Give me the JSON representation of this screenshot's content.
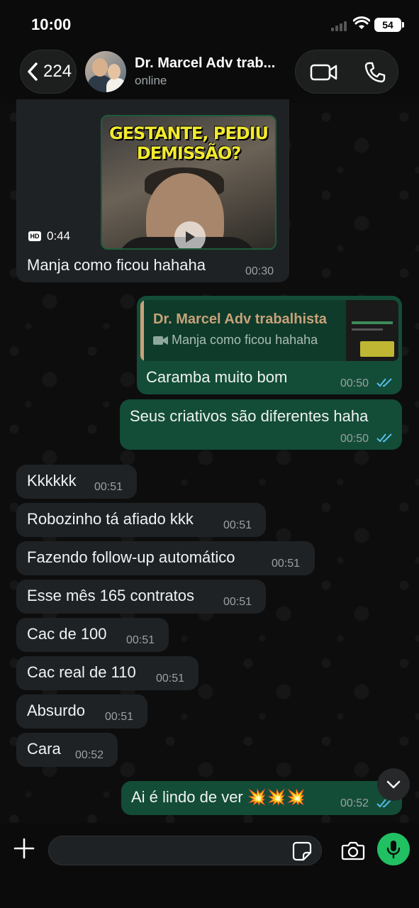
{
  "status_bar": {
    "time": "10:00",
    "battery": "54"
  },
  "header": {
    "back_count": "224",
    "contact_name": "Dr. Marcel Adv trab...",
    "contact_status": "online"
  },
  "messages": [
    {
      "id": "m1",
      "direction": "in",
      "type": "video",
      "video_title": "GESTANTE, PEDIU DEMISSÃO?",
      "duration": "0:44",
      "text": "Manja como ficou hahaha",
      "time": "00:30"
    },
    {
      "id": "m2",
      "direction": "out",
      "type": "reply",
      "quote_name": "Dr. Marcel Adv trabalhista",
      "quote_text": "Manja como ficou hahaha",
      "text": "Caramba muito bom",
      "time": "00:50"
    },
    {
      "id": "m3",
      "direction": "out",
      "text": "Seus criativos são diferentes haha",
      "time": "00:50"
    },
    {
      "id": "m4",
      "direction": "in",
      "text": "Kkkkkk",
      "time": "00:51"
    },
    {
      "id": "m5",
      "direction": "in",
      "text": "Robozinho tá afiado kkk",
      "time": "00:51"
    },
    {
      "id": "m6",
      "direction": "in",
      "text": "Fazendo follow-up automático",
      "time": "00:51"
    },
    {
      "id": "m7",
      "direction": "in",
      "text": "Esse mês 165 contratos",
      "time": "00:51"
    },
    {
      "id": "m8",
      "direction": "in",
      "text": "Cac de 100",
      "time": "00:51"
    },
    {
      "id": "m9",
      "direction": "in",
      "text": "Cac real de 110",
      "time": "00:51"
    },
    {
      "id": "m10",
      "direction": "in",
      "text": "Absurdo",
      "time": "00:51"
    },
    {
      "id": "m11",
      "direction": "in",
      "text": "Cara",
      "time": "00:52"
    },
    {
      "id": "m12",
      "direction": "out",
      "text": "Ai é lindo de ver 💥💥💥",
      "time": "00:52"
    }
  ],
  "composer": {
    "input_value": "",
    "placeholder": ""
  },
  "colors": {
    "incoming_bubble": "#1f2225",
    "outgoing_bubble": "#134d37",
    "accent_green": "#21c063",
    "read_ticks": "#53bdeb",
    "quote_name": "#c7a27a"
  },
  "icons": [
    "back-chevron-icon",
    "video-call-icon",
    "phone-call-icon",
    "play-icon",
    "hd-icon",
    "double-check-icon",
    "chevron-down-icon",
    "plus-icon",
    "sticker-icon",
    "camera-icon",
    "mic-icon"
  ]
}
